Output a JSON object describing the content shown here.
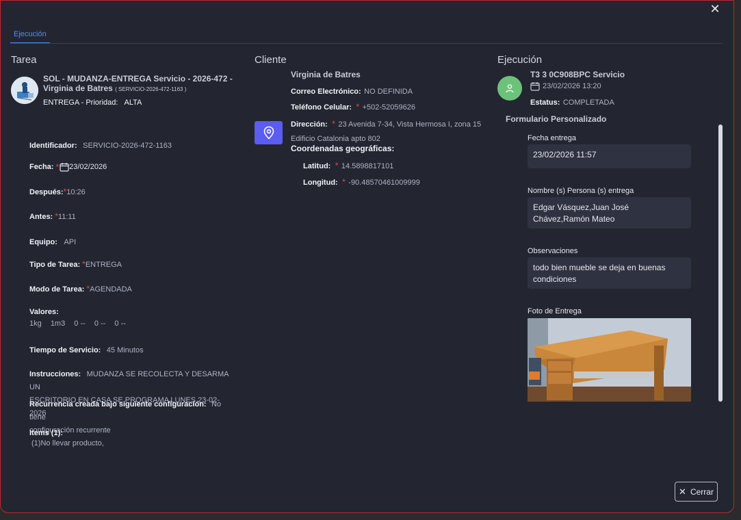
{
  "close_icon": "close-icon",
  "tab": {
    "label": "Ejecución"
  },
  "task": {
    "section_title": "Tarea",
    "title_line1": "SOL - MUDANZA-ENTREGA Servicio - 2026-472 -",
    "title_line2": "Virginia de Batres",
    "title_code": "( SERVICIO-2026-472-1163 )",
    "type_priority": "ENTREGA - Prioridad:",
    "priority": "ALTA",
    "fields": {
      "identificador_label": "Identificador:",
      "identificador_value": "SERVICIO-2026-472-1163",
      "fecha_label": "Fecha:",
      "fecha_value": "23/02/2026",
      "despues_label": "Después:",
      "despues_value": "10:26",
      "antes_label": "Antes:",
      "antes_value": "11:11",
      "equipo_label": "Equipo:",
      "equipo_value": "API",
      "tipo_label": "Tipo de Tarea:",
      "tipo_value": "ENTREGA",
      "modo_label": "Modo de Tarea:",
      "modo_value": "AGENDADA",
      "valores_label": "Valores:",
      "valores": [
        "1kg",
        "1m3",
        "0 --",
        "0 --",
        "0 --"
      ],
      "tiempo_label": "Tiempo de Servicio:",
      "tiempo_value": "45 Minutos",
      "instrucciones_label": "Instrucciones:",
      "instrucciones_value_1": "MUDANZA SE RECOLECTA Y DESARMA UN",
      "instrucciones_value_2": "ESCRITORIO EN CASA SE PROGRAMA LUNES 23-02-2026",
      "recurrencia_label": "Recurrencia creada bajo siguiente configuración:",
      "recurrencia_value_1": "No tiene",
      "recurrencia_value_2": "configuración recurrente",
      "items_label": "Items (1):",
      "items_value": "(1)No llevar producto,"
    }
  },
  "client": {
    "section_title": "Cliente",
    "name": "Virginia de Batres",
    "email_label": "Correo Electrónico:",
    "email_value": "NO DEFINIDA",
    "phone_label": "Teléfono Celular:",
    "phone_value": "+502-52059626",
    "address_label": "Dirección:",
    "address_value_1": "23 Avenida 7-34, Vista Hermosa I, zona 15",
    "address_value_2": "Edificio Catalonia apto 802",
    "geo_title": "Coordenadas geográficas:",
    "lat_label": "Latitud:",
    "lat_value": "14.5898817101",
    "lng_label": "Longitud:",
    "lng_value": "-90.48570461009999"
  },
  "execution": {
    "section_title": "Ejecución",
    "vehicle": "T3 3 0C908BPC Servicio",
    "datetime": "23/02/2026 13:20",
    "status_label": "Estatus:",
    "status_value": "COMPLETADA",
    "form_title": "Formulario Personalizado",
    "fecha_entrega_label": "Fecha entrega",
    "fecha_entrega_value": "23/02/2026 11:57",
    "persona_label": "Nombre (s) Persona (s) entrega",
    "persona_value": "Edgar Vásquez,Juan José Chávez,Ramón Mateo",
    "observaciones_label": "Observaciones",
    "observaciones_value": "todo bien mueble se deja en buenas condiciones",
    "foto_label": "Foto de Entrega"
  },
  "footer": {
    "close_label": "Cerrar"
  },
  "colors": {
    "accent": "#4f8ff7",
    "location_tile": "#5b5cf0",
    "avatar_green": "#6cc27a",
    "required_star": "#e04b4b"
  }
}
